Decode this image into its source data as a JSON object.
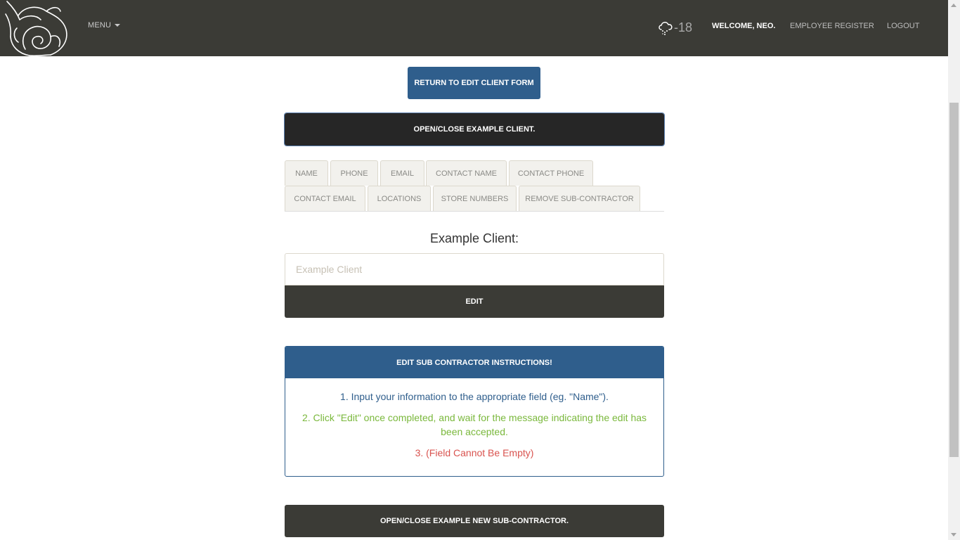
{
  "nav": {
    "logo": "rose-logo",
    "menu_label": "MENU",
    "weather_icon": "snow-cloud-icon",
    "temperature": "-18",
    "welcome": "WELCOME, NEO.",
    "employee_register": "EMPLOYEE REGISTER",
    "logout": "LOGOUT"
  },
  "return_button": "RETURN TO EDIT CLIENT FORM",
  "open_close_client": "OPEN/CLOSE EXAMPLE CLIENT.",
  "tabs": [
    {
      "label": "NAME"
    },
    {
      "label": "PHONE"
    },
    {
      "label": "EMAIL"
    },
    {
      "label": "CONTACT NAME"
    },
    {
      "label": "CONTACT PHONE"
    },
    {
      "label": "CONTACT EMAIL"
    },
    {
      "label": "LOCATIONS"
    },
    {
      "label": "STORE NUMBERS"
    },
    {
      "label": "REMOVE SUB-CONTRACTOR"
    }
  ],
  "client_title": "Example Client:",
  "client_input": {
    "value": "",
    "placeholder": "Example Client"
  },
  "edit_button": "EDIT",
  "instructions": {
    "title": "EDIT SUB CONTRACTOR INSTRUCTIONS!",
    "items": [
      "1. Input your information to the appropriate field (eg. \"Name\").",
      "2. Click \"Edit\" once completed, and wait for the message indicating the edit has been accepted.",
      "3. (Field Cannot Be Empty)"
    ]
  },
  "open_close_new": "OPEN/CLOSE EXAMPLE NEW SUB-CONTRACTOR.",
  "colors": {
    "navbar": "#3b3b36",
    "primary_blue": "#2f5e8c",
    "success_green": "#7ab83c",
    "danger_red": "#d9534f"
  }
}
